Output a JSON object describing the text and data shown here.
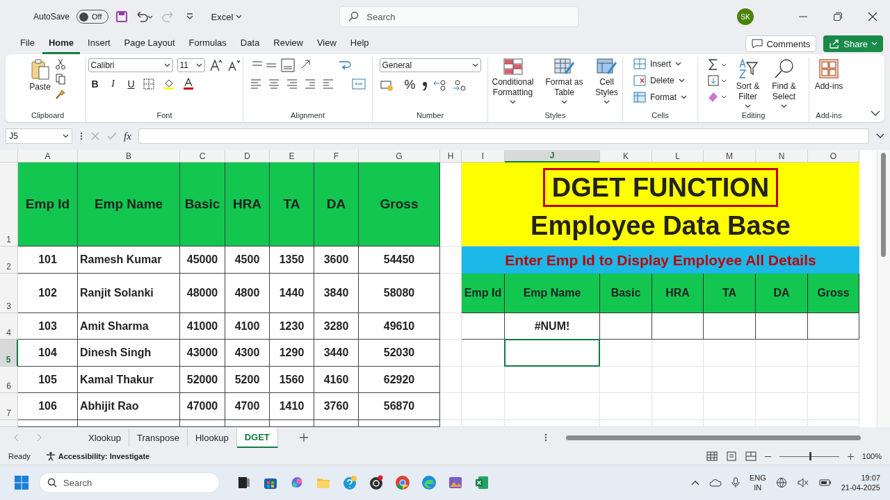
{
  "title_bar": {
    "autosave_label": "AutoSave",
    "autosave": {
      "on": false,
      "label": "Off"
    },
    "app_menu": "Excel",
    "search": {
      "placeholder": "Search"
    },
    "avatar": "SK"
  },
  "menu_tabs": [
    {
      "label": "File",
      "selected": false
    },
    {
      "label": "Home",
      "selected": true
    },
    {
      "label": "Insert",
      "selected": false
    },
    {
      "label": "Page Layout",
      "selected": false
    },
    {
      "label": "Formulas",
      "selected": false
    },
    {
      "label": "Data",
      "selected": false
    },
    {
      "label": "Review",
      "selected": false
    },
    {
      "label": "View",
      "selected": false
    },
    {
      "label": "Help",
      "selected": false
    }
  ],
  "comments": "Comments",
  "share": "Share",
  "ribbon": {
    "paste": "Paste",
    "font_name": "Calibri",
    "font_size": "11",
    "bold": "B",
    "italic": "I",
    "underline": "U",
    "number_format": "General",
    "percent": "%",
    "conditional_formatting": "Conditional Formatting",
    "format_as_table": "Format as Table",
    "cell_styles": "Cell Styles",
    "insert": "Insert",
    "delete": "Delete",
    "format": "Format",
    "sort_filter": "Sort & Filter",
    "find_select": "Find & Select",
    "add_ins": "Add-ins",
    "group_labels": [
      "Clipboard",
      "Font",
      "Alignment",
      "Number",
      "Styles",
      "Cells",
      "Editing",
      "Add-ins"
    ]
  },
  "formula_bar": {
    "name_box": "J5",
    "fx": "fx"
  },
  "sheet": {
    "columns": [
      {
        "label": "A",
        "selected": false
      },
      {
        "label": "B",
        "selected": false
      },
      {
        "label": "C",
        "selected": false
      },
      {
        "label": "D",
        "selected": false
      },
      {
        "label": "E",
        "selected": false
      },
      {
        "label": "F",
        "selected": false
      },
      {
        "label": "G",
        "selected": false
      },
      {
        "label": "H",
        "selected": false
      },
      {
        "label": "I",
        "selected": false
      },
      {
        "label": "J",
        "selected": true
      },
      {
        "label": "K",
        "selected": false
      },
      {
        "label": "L",
        "selected": false
      },
      {
        "label": "M",
        "selected": false
      },
      {
        "label": "N",
        "selected": false
      },
      {
        "label": "O",
        "selected": false
      }
    ],
    "rows": [
      {
        "label": "1",
        "selected": false
      },
      {
        "label": "2",
        "selected": false
      },
      {
        "label": "3",
        "selected": false
      },
      {
        "label": "4",
        "selected": false
      },
      {
        "label": "5",
        "selected": true
      },
      {
        "label": "6",
        "selected": false
      },
      {
        "label": "7",
        "selected": false
      }
    ],
    "employees": {
      "headers": [
        "Emp Id",
        "Emp Name",
        "Basic",
        "HRA",
        "TA",
        "DA",
        "Gross"
      ],
      "rows": [
        [
          "101",
          "Ramesh Kumar",
          "45000",
          "4500",
          "1350",
          "3600",
          "54450"
        ],
        [
          "102",
          "Ranjit Solanki",
          "48000",
          "4800",
          "1440",
          "3840",
          "58080"
        ],
        [
          "103",
          "Amit Sharma",
          "41000",
          "4100",
          "1230",
          "3280",
          "49610"
        ],
        [
          "104",
          "Dinesh Singh",
          "43000",
          "4300",
          "1290",
          "3440",
          "52030"
        ],
        [
          "105",
          "Kamal Thakur",
          "52000",
          "5200",
          "1560",
          "4160",
          "62920"
        ],
        [
          "106",
          "Abhijit Rao",
          "47000",
          "4700",
          "1410",
          "3760",
          "56870"
        ]
      ]
    },
    "lookup": {
      "title": "DGET FUNCTION",
      "subtitle": "Employee Data Base",
      "instruction": "Enter Emp Id to Display Employee All Details",
      "headers": [
        "Emp Id",
        "Emp Name",
        "Basic",
        "HRA",
        "TA",
        "DA",
        "Gross"
      ],
      "result": "#NUM!"
    }
  },
  "sheet_tabs": [
    {
      "label": "Xlookup",
      "selected": false
    },
    {
      "label": "Transpose",
      "selected": false
    },
    {
      "label": "Hlookup",
      "selected": false
    },
    {
      "label": "DGET",
      "selected": true
    }
  ],
  "status_bar": {
    "ready": "Ready",
    "accessibility": "Accessibility: Investigate",
    "zoom": {
      "level": 0.5
    },
    "zoom_reading": "100%"
  },
  "taskbar": {
    "search": {
      "placeholder": "Search"
    },
    "language": "ENG",
    "region": "IN",
    "time": "19:07",
    "date": "21-04-2025"
  }
}
